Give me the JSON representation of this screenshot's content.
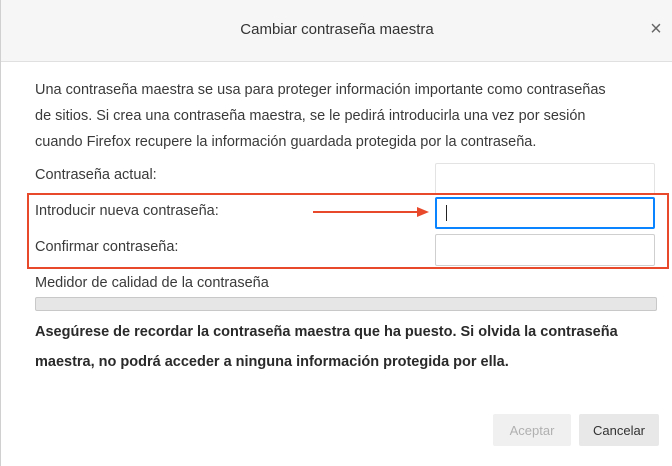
{
  "dialog": {
    "title": "Cambiar contraseña maestra",
    "close_glyph": "×"
  },
  "description": {
    "lines": [
      "Una contraseña maestra se usa para proteger información importante como contraseñas",
      "de sitios. Si crea una contraseña maestra, se le pedirá introducirla una vez por sesión",
      "cuando Firefox recupere la información guardada protegida por la contraseña."
    ]
  },
  "form": {
    "current_label": "Contraseña actual:",
    "current_value": "",
    "new_label": "Introducir nueva contraseña:",
    "new_value": "",
    "confirm_label": "Confirmar contraseña:",
    "confirm_value": ""
  },
  "meter": {
    "label": "Medidor de calidad de la contraseña",
    "level": 0
  },
  "warning": {
    "lines": [
      "Asegúrese de recordar la contraseña maestra que ha puesto. Si olvida la contraseña",
      "maestra, no podrá acceder a ninguna información protegida por ella."
    ]
  },
  "buttons": {
    "accept": "Aceptar",
    "cancel": "Cancelar"
  },
  "annotation": {
    "color": "#e8492a"
  },
  "colors": {
    "focus": "#0a84ff"
  }
}
